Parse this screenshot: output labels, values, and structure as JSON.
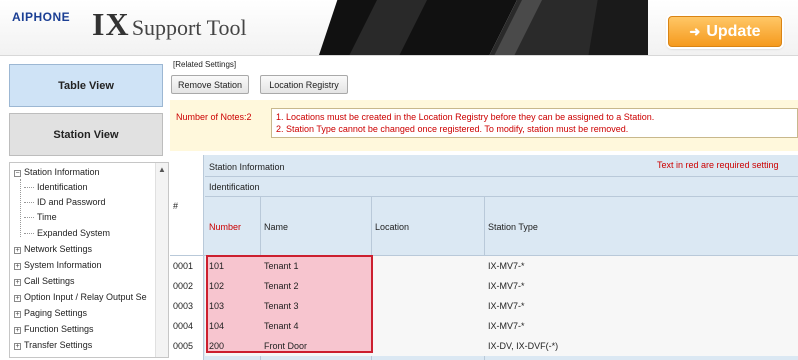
{
  "header": {
    "brand": "AIPHONE",
    "title_big": "IX",
    "title_rest": "Support Tool",
    "update_label": "Update"
  },
  "views": {
    "table_view": "Table View",
    "station_view": "Station View"
  },
  "tree": {
    "items": [
      {
        "label": "Station Information",
        "expanded": true
      },
      {
        "label": "Network Settings"
      },
      {
        "label": "System Information"
      },
      {
        "label": "Call Settings"
      },
      {
        "label": "Option Input / Relay Output Se"
      },
      {
        "label": "Paging Settings"
      },
      {
        "label": "Function Settings"
      },
      {
        "label": "Transfer Settings"
      }
    ],
    "children": [
      "Identification",
      "ID and Password",
      "Time",
      "Expanded System"
    ]
  },
  "related": {
    "label": "[Related Settings]",
    "remove_station": "Remove Station",
    "location_registry": "Location Registry"
  },
  "notes": {
    "label": "Number of Notes:2",
    "line1": "1. Locations must be created in the Location Registry before they can be assigned to a Station.",
    "line2": "2. Station Type cannot be changed once registered. To modify, station must be removed."
  },
  "table": {
    "group_header": "Station Information",
    "sub_header": "Identification",
    "required_note": "Text in red are required setting",
    "hash": "#",
    "columns": {
      "number": "Number",
      "name": "Name",
      "location": "Location",
      "station_type": "Station Type"
    },
    "rows": [
      {
        "idx": "0001",
        "number": "101",
        "name": "Tenant 1",
        "location": "",
        "type": "IX-MV7-*"
      },
      {
        "idx": "0002",
        "number": "102",
        "name": "Tenant 2",
        "location": "",
        "type": "IX-MV7-*"
      },
      {
        "idx": "0003",
        "number": "103",
        "name": "Tenant 3",
        "location": "",
        "type": "IX-MV7-*"
      },
      {
        "idx": "0004",
        "number": "104",
        "name": "Tenant 4",
        "location": "",
        "type": "IX-MV7-*"
      },
      {
        "idx": "0005",
        "number": "200",
        "name": "Front Door",
        "location": "",
        "type": "IX-DV, IX-DVF(-*)"
      }
    ]
  },
  "colors": {
    "brand_blue": "#1b3f94",
    "update_orange": "#f59a1e",
    "required_red": "#cc0000",
    "highlight_border": "#cc1f2f",
    "highlight_fill": "#f7c5cf"
  }
}
